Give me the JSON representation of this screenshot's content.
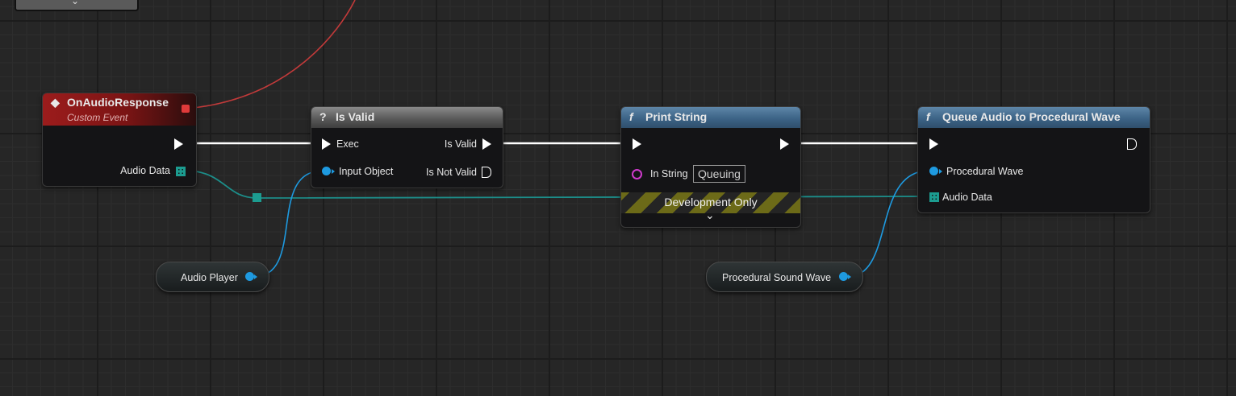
{
  "nodes": {
    "event": {
      "title": "OnAudioResponse",
      "subtitle": "Custom Event",
      "pin_audio_data": "Audio Data"
    },
    "is_valid": {
      "icon": "?",
      "title": "Is Valid",
      "pin_exec": "Exec",
      "pin_input_object": "Input Object",
      "pin_is_valid": "Is Valid",
      "pin_is_not_valid": "Is Not Valid"
    },
    "print_string": {
      "icon": "f",
      "title": "Print String",
      "pin_in_string": "In String",
      "in_string_value": "Queuing",
      "dev_only": "Development Only",
      "expand_icon": "⌄"
    },
    "queue_audio": {
      "icon": "f",
      "title": "Queue Audio to Procedural Wave",
      "pin_procedural_wave": "Procedural Wave",
      "pin_audio_data": "Audio Data"
    }
  },
  "variables": {
    "audio_player": "Audio Player",
    "procedural_sound_wave": "Procedural Sound Wave"
  },
  "colors": {
    "exec_wire": "#ffffff",
    "object_wire": "#1e9ae0",
    "array_wire": "#1c8e8a",
    "event_wire": "#c23a3a"
  }
}
